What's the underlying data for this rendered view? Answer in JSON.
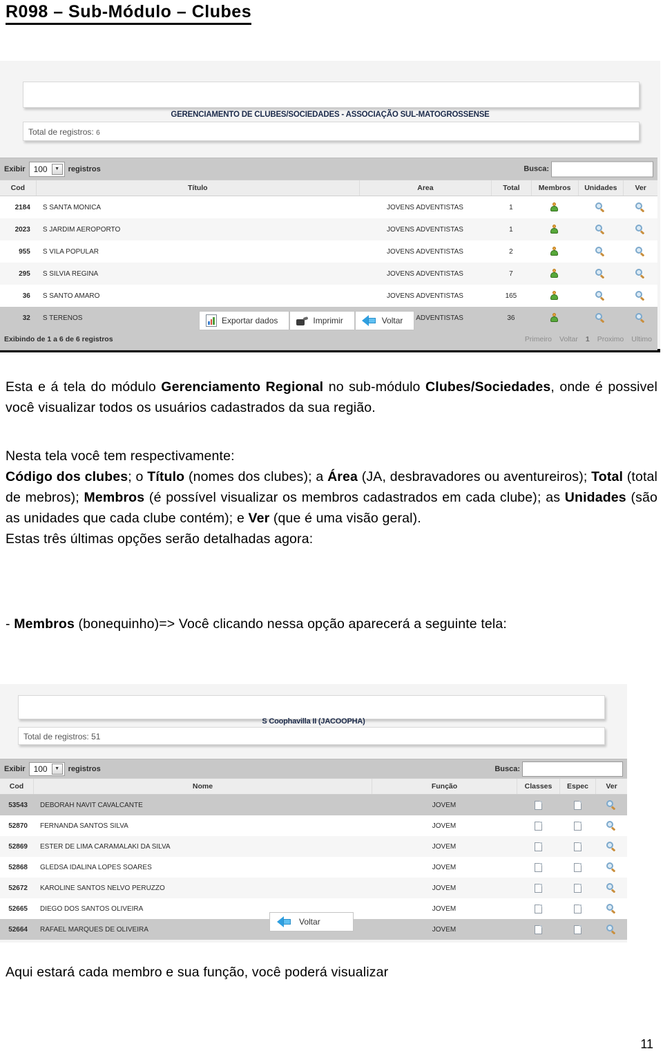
{
  "document": {
    "title": "R098 – Sub-Módulo – Clubes",
    "page_number": "11"
  },
  "screenshot_clubes": {
    "heading": "GERENCIAMENTO DE CLUBES/SOCIEDADES - ASSOCIAÇÃO SUL-MATOGROSSENSE",
    "total_label": "Total de registros:",
    "total_value": "6",
    "toolbar": {
      "exibir_label": "Exibir",
      "page_size": "100",
      "registros_label": "registros",
      "busca_label": "Busca:",
      "busca_value": ""
    },
    "columns": [
      "Cod",
      "Título",
      "Area",
      "Total",
      "Membros",
      "Unidades",
      "Ver"
    ],
    "rows": [
      {
        "cod": "2184",
        "titulo": "S SANTA MÔNICA",
        "area": "JOVENS ADVENTISTAS",
        "total": "1"
      },
      {
        "cod": "2023",
        "titulo": "S JARDIM AEROPORTO",
        "area": "JOVENS ADVENTISTAS",
        "total": "1"
      },
      {
        "cod": "955",
        "titulo": "S VILA POPULAR",
        "area": "JOVENS ADVENTISTAS",
        "total": "2"
      },
      {
        "cod": "295",
        "titulo": "S SILVIA REGINA",
        "area": "JOVENS ADVENTISTAS",
        "total": "7"
      },
      {
        "cod": "36",
        "titulo": "S SANTO AMARO",
        "area": "JOVENS ADVENTISTAS",
        "total": "165"
      },
      {
        "cod": "32",
        "titulo": "S TERENOS",
        "area": "JOVENS ADVENTISTAS",
        "total": "36"
      }
    ],
    "footer_info": "Exibindo de 1 a 6 de 6 registros",
    "buttons": [
      {
        "label": "Exportar dados",
        "icon": "export-icon"
      },
      {
        "label": "Imprimir",
        "icon": "printer-icon"
      },
      {
        "label": "Voltar",
        "icon": "back-arrow-icon"
      }
    ],
    "pager": [
      "Primeiro",
      "Voltar",
      "1",
      "Proximo",
      "Ultimo"
    ]
  },
  "screenshot_membros": {
    "heading": "S Coophavilla II (JACOOPHA)",
    "total_label": "Total de registros:",
    "total_value": "51",
    "toolbar": {
      "exibir_label": "Exibir",
      "page_size": "100",
      "registros_label": "registros",
      "busca_label": "Busca:",
      "busca_value": ""
    },
    "columns": [
      "Cod",
      "Nome",
      "Função",
      "Classes",
      "Espec",
      "Ver"
    ],
    "rows": [
      {
        "cod": "53543",
        "nome": "DEBORAH NAVIT CAVALCANTE",
        "funcao": "JOVEM"
      },
      {
        "cod": "52870",
        "nome": "FERNANDA SANTOS SILVA",
        "funcao": "JOVEM"
      },
      {
        "cod": "52869",
        "nome": "ESTER DE LIMA CARAMALAKI DA SILVA",
        "funcao": "JOVEM"
      },
      {
        "cod": "52868",
        "nome": "GLEDSA IDALINA LOPES SOARES",
        "funcao": "JOVEM"
      },
      {
        "cod": "52672",
        "nome": "KAROLINE SANTOS NELVO PERUZZO",
        "funcao": "JOVEM"
      },
      {
        "cod": "52665",
        "nome": "DIEGO DOS SANTOS OLIVEIRA",
        "funcao": "JOVEM"
      },
      {
        "cod": "52664",
        "nome": "RAFAEL MARQUES DE OLIVEIRA",
        "funcao": "JOVEM"
      }
    ],
    "button": {
      "label": "Voltar",
      "icon": "back-arrow-icon"
    }
  },
  "body_text": {
    "p1_a": "Esta e á tela do módulo ",
    "p1_b": "Gerenciamento Regional",
    "p1_c": " no sub-módulo ",
    "p1_d": "Clubes/Sociedades",
    "p1_e": ", onde é possivel você visualizar todos os usuários cadastrados da sua região.",
    "p2_a": "Nesta tela você tem respectivamente:",
    "p2_b": "Código dos clubes",
    "p2_c": "; o ",
    "p2_d": "Título",
    "p2_e": " (nomes dos clubes); a ",
    "p2_f": "Área",
    "p2_g": " (JA, desbravadores ou aventureiros); ",
    "p2_h": "Total",
    "p2_i": " (total de mebros); ",
    "p2_j": "Membros",
    "p2_k": " (é possível visualizar os membros cadastrados em cada clube); as ",
    "p2_l": "Unidades",
    "p2_m": " (são as unidades que cada clube contém); e ",
    "p2_n": "Ver",
    "p2_o": " (que é uma visão geral).",
    "p2_p": "Estas três últimas opções serão detalhadas agora:",
    "p3_a": "- ",
    "p3_b": "Membros",
    "p3_c": " (bonequinho)=> Você clicando nessa opção aparecerá a seguinte tela:",
    "p4": "Aqui estará cada membro e sua função, você poderá visualizar"
  }
}
